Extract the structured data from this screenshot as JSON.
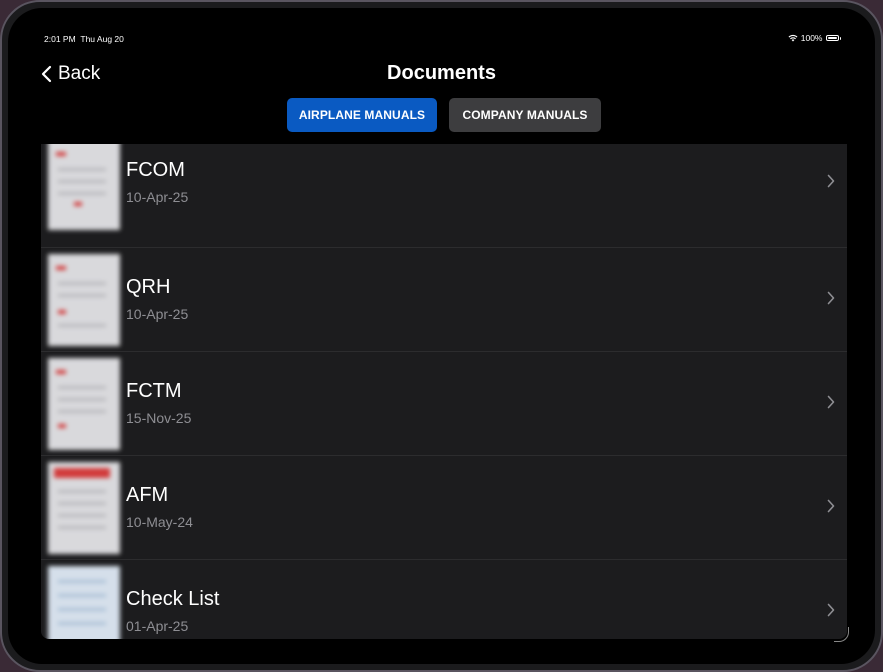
{
  "status_bar": {
    "time": "2:01 PM",
    "date": "Thu Aug 20",
    "battery": "100%",
    "icons": [
      "wifi-icon",
      "battery-icon"
    ]
  },
  "nav": {
    "back_label": "Back",
    "title": "Documents"
  },
  "tabs": [
    {
      "label": "AIRPLANE MANUALS",
      "active": true
    },
    {
      "label": "COMPANY MANUALS",
      "active": false
    }
  ],
  "documents": [
    {
      "title": "FCOM",
      "date": "10-Apr-25"
    },
    {
      "title": "QRH",
      "date": "10-Apr-25"
    },
    {
      "title": "FCTM",
      "date": "15-Nov-25"
    },
    {
      "title": "AFM",
      "date": "10-May-24"
    },
    {
      "title": "Check List",
      "date": "01-Apr-25"
    }
  ],
  "colors": {
    "accent": "#0a5ac2",
    "background": "#000000",
    "list_background": "#1c1c1e",
    "secondary_text": "#8e8e93",
    "inactive_tab": "#3d3d3f"
  }
}
